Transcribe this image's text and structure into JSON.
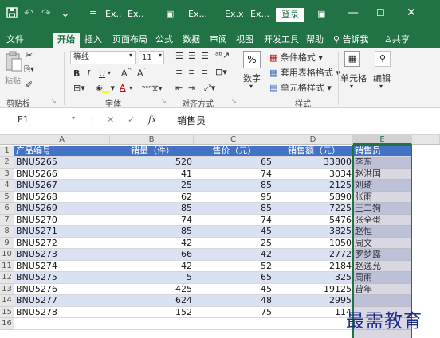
{
  "title_bar": {
    "quick_access": [
      "save-icon",
      "undo-icon",
      "redo-icon",
      "customize-icon"
    ],
    "file_parts": [
      "Ex..",
      "Ex..",
      "Ex...",
      "Ex.x",
      "Ex..."
    ],
    "login_label": "登录"
  },
  "ribbon_tabs": [
    "文件",
    "开始",
    "插入",
    "页面布局",
    "公式",
    "数据",
    "审阅",
    "视图",
    "开发工具",
    "帮助",
    "告诉我",
    "共享"
  ],
  "active_tab": "开始",
  "ribbon": {
    "font_name": "等线",
    "font_size": "11",
    "groups": {
      "clipboard": "剪贴板",
      "font": "字体",
      "alignment": "对齐方式",
      "number": "数字",
      "styles": "样式",
      "cells": "单元格",
      "editing": "编辑"
    },
    "paste_label": "粘贴",
    "number_button": "数字",
    "style_items": [
      "条件格式",
      "套用表格格式",
      "单元格样式"
    ],
    "cells_button": "单元格",
    "editing_button": "编辑"
  },
  "formula_bar": {
    "name_box": "E1",
    "fx_label": "fx",
    "content": "销售员"
  },
  "columns": [
    "A",
    "B",
    "C",
    "D",
    "E"
  ],
  "selected_column": "E",
  "table": {
    "headers": [
      "产品编号",
      "销量（件）",
      "售价（元）",
      "销售额（元）",
      "销售员"
    ],
    "rows": [
      [
        "BNU5265",
        "520",
        "65",
        "33800",
        "李东"
      ],
      [
        "BNU5266",
        "41",
        "74",
        "3034",
        "赵洪国"
      ],
      [
        "BNU5267",
        "25",
        "85",
        "2125",
        "刘琦"
      ],
      [
        "BNU5268",
        "62",
        "95",
        "5890",
        "张雨"
      ],
      [
        "BNU5269",
        "85",
        "85",
        "7225",
        "王二狗"
      ],
      [
        "BNU5270",
        "74",
        "74",
        "5476",
        "张全蛋"
      ],
      [
        "BNU5271",
        "85",
        "45",
        "3825",
        "赵恒"
      ],
      [
        "BNU5272",
        "42",
        "25",
        "1050",
        "周文"
      ],
      [
        "BNU5273",
        "66",
        "42",
        "2772",
        "罗梦露"
      ],
      [
        "BNU5274",
        "42",
        "52",
        "2184",
        "赵逸允"
      ],
      [
        "BNU5275",
        "5",
        "65",
        "325",
        "周雨"
      ],
      [
        "BNU5276",
        "425",
        "45",
        "19125",
        "曾年"
      ],
      [
        "BNU5277",
        "624",
        "48",
        "2995",
        ""
      ],
      [
        "BNU5278",
        "152",
        "75",
        "114",
        ""
      ]
    ]
  },
  "row_numbers": [
    "1",
    "2",
    "3",
    "4",
    "5",
    "6",
    "7",
    "8",
    "9",
    "10",
    "11",
    "12",
    "13",
    "14",
    "15",
    "16"
  ],
  "watermark": "最需教育",
  "colors": {
    "excel_green": "#217346",
    "header_blue": "#4472c4",
    "band_blue": "#d9e1f2"
  }
}
